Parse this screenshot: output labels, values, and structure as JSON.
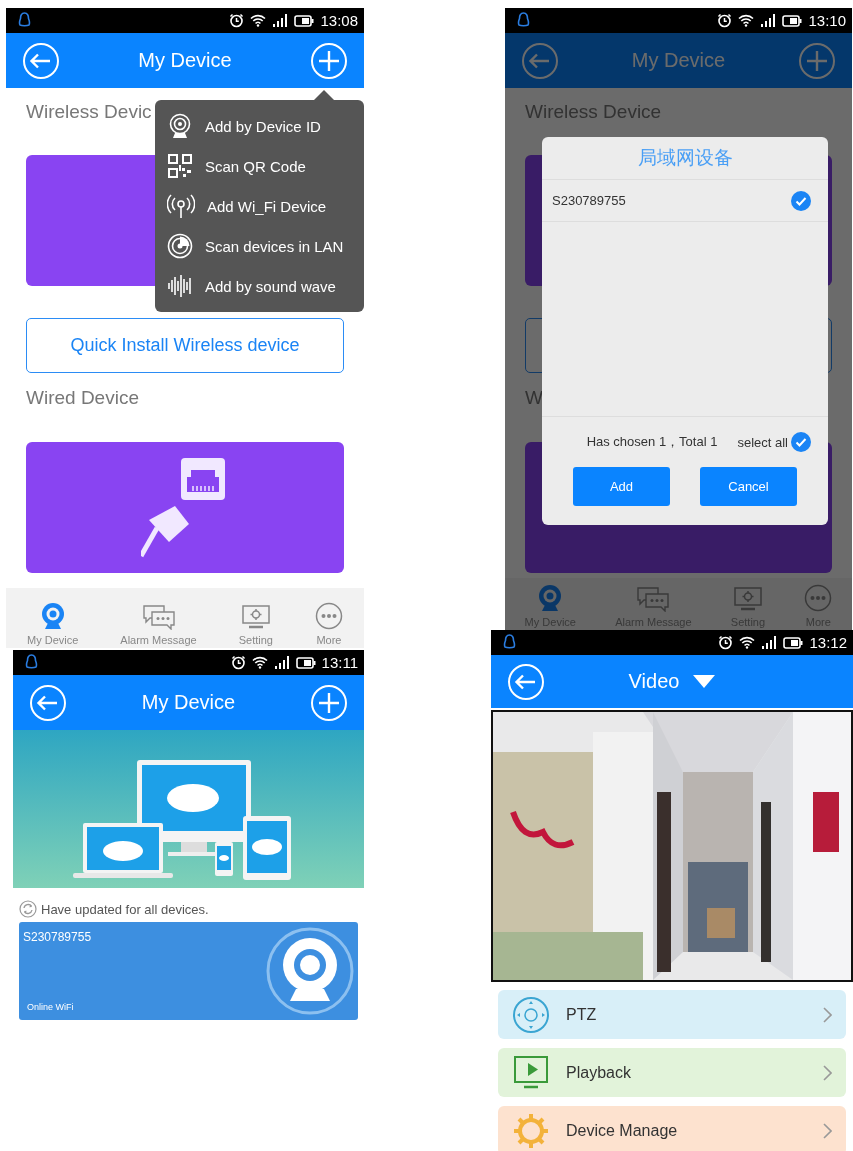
{
  "screens": [
    {
      "kind": "add_menu",
      "status_bar": {
        "time": "13:08"
      },
      "header": {
        "title": "My Device"
      },
      "blocks": [
        {
          "kind": "heading",
          "text": "Wireless Devic"
        },
        {
          "kind": "blank_card"
        },
        {
          "kind": "outline_button",
          "text": "Quick Install Wireless device"
        },
        {
          "kind": "heading",
          "text": "Wired Device"
        },
        {
          "kind": "wired_card"
        }
      ],
      "popup_menu": [
        {
          "label": "Add by Device ID",
          "kind": "device_id"
        },
        {
          "label": "Scan QR Code",
          "kind": "qr"
        },
        {
          "label": "Add Wi_Fi Device",
          "kind": "wifi"
        },
        {
          "label": "Scan devices in LAN",
          "kind": "lan"
        },
        {
          "label": "Add by sound wave",
          "kind": "sound"
        }
      ],
      "nav": [
        {
          "label": "My Device",
          "kind": "device",
          "selected": true
        },
        {
          "label": "Alarm Message",
          "kind": "alarm",
          "selected": false
        },
        {
          "label": "Setting",
          "kind": "setting",
          "selected": false
        },
        {
          "label": "More",
          "kind": "more",
          "selected": false
        }
      ]
    },
    {
      "kind": "device_list",
      "status_bar": {
        "time": "13:11"
      },
      "header": {
        "title": "My Device"
      },
      "sync_status": "Have updated for all devices.",
      "devices": [
        {
          "name": "S230789755",
          "status": "Online WiFi"
        }
      ]
    },
    {
      "kind": "lan_dialog",
      "status_bar": {
        "time": "13:10"
      },
      "header": {
        "title": "My Device"
      },
      "blocks": [
        {
          "kind": "heading",
          "text": "Wireless Device"
        },
        {
          "kind": "blank_card"
        },
        {
          "kind": "outline_button"
        },
        {
          "kind": "heading",
          "text": "W"
        },
        {
          "kind": "blank_card"
        }
      ],
      "dialog": {
        "title": "局域网设备",
        "items": [
          {
            "label": "S230789755",
            "checked": true
          }
        ],
        "summary": "Has chosen 1，Total 1",
        "select_all": {
          "label": "select all",
          "checked": true
        },
        "buttons": [
          "Add",
          "Cancel"
        ]
      },
      "nav": [
        {
          "label": "My Device",
          "kind": "device",
          "selected": true
        },
        {
          "label": "Alarm Message",
          "kind": "alarm",
          "selected": false
        },
        {
          "label": "Setting",
          "kind": "setting",
          "selected": false
        },
        {
          "label": "More",
          "kind": "more",
          "selected": false
        }
      ]
    },
    {
      "kind": "video",
      "status_bar": {
        "time": "13:12"
      },
      "header": {
        "title": "Video"
      },
      "actions": [
        {
          "label": "PTZ",
          "kind": "ptz",
          "color": "#d8eff8"
        },
        {
          "label": "Playback",
          "kind": "playback",
          "color": "#e2f3da"
        },
        {
          "label": "Device Manage",
          "kind": "manage",
          "color": "#fde2cf"
        }
      ]
    }
  ]
}
